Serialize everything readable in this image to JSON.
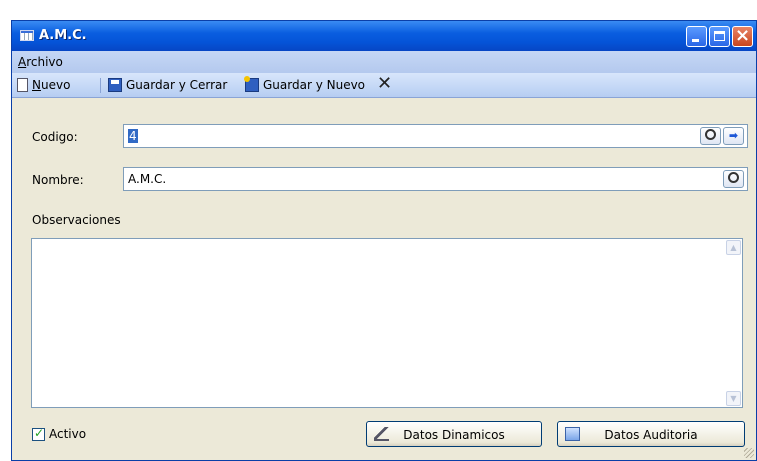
{
  "window": {
    "title": "A.M.C."
  },
  "menu": {
    "items": [
      {
        "label": "Archivo",
        "mnemonic": "A",
        "rest": "rchivo"
      }
    ]
  },
  "toolbar": {
    "nuevo_mnemonic": "N",
    "nuevo_rest": "uevo",
    "guardar_cerrar": "Guardar y Cerrar",
    "guardar_nuevo": "Guardar y Nuevo",
    "close_glyph": "✕"
  },
  "form": {
    "codigo_label": "Codigo:",
    "codigo_value": "4",
    "nombre_label": "Nombre:",
    "nombre_value": "A.M.C.",
    "observaciones_label": "Observaciones",
    "observaciones_value": ""
  },
  "footer": {
    "activo_label": "Activo",
    "activo_checked": true,
    "datos_dinamicos": "Datos Dinamicos",
    "datos_auditoria": "Datos Auditoria"
  },
  "icons": {
    "app": "table-icon",
    "nuevo": "new-document-icon",
    "guardar_cerrar": "save-icon",
    "guardar_nuevo": "save-new-icon",
    "search": "search-icon",
    "next": "arrow-right-icon"
  },
  "colors": {
    "titlebar": "#0554d8",
    "window_bg": "#ece9d8",
    "selection": "#316ac5"
  }
}
